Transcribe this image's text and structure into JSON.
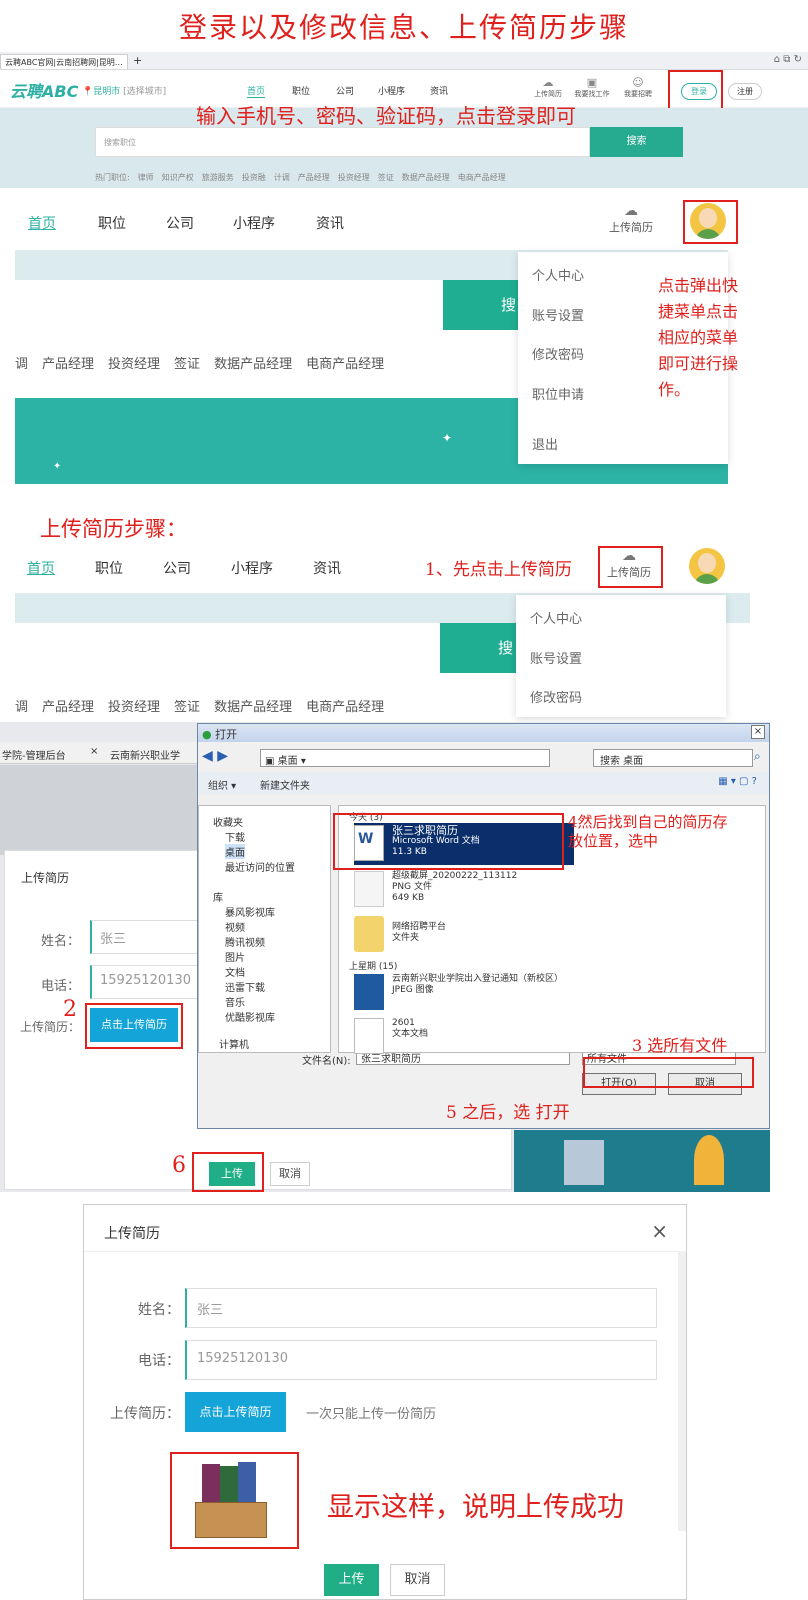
{
  "title": "登录以及修改信息、上传简历步骤",
  "browser": {
    "tab": "云聘ABC官网|云南招聘网|昆明…",
    "plus": "+"
  },
  "site": {
    "logo": "云聘ABC",
    "city": "昆明市",
    "city_select": "[选择城市]",
    "nav_small": [
      "首页",
      "职位",
      "公司",
      "小程序",
      "资讯"
    ],
    "icons_small": [
      "上传简历",
      "我要找工作",
      "我要招聘"
    ],
    "login": "登录",
    "register": "注册",
    "search_placeholder": "搜索职位",
    "search_btn": "搜索",
    "hot_label": "热门职位:",
    "hot": [
      "律师",
      "知识产权",
      "旅游服务",
      "投资融",
      "计调",
      "产品经理",
      "投资经理",
      "签证",
      "数据产品经理",
      "电商产品经理"
    ]
  },
  "step_login": "输入手机号、密码、验证码，点击登录即可",
  "nav": [
    "首页",
    "职位",
    "公司",
    "小程序",
    "资讯"
  ],
  "upload_resume": "上传简历",
  "search_partial": "搜",
  "tags": [
    "调",
    "产品经理",
    "投资经理",
    "签证",
    "数据产品经理",
    "电商产品经理"
  ],
  "dropdown": [
    "个人中心",
    "账号设置",
    "修改密码",
    "职位申请",
    "退出"
  ],
  "menu_note": [
    "点击弹出快",
    "捷菜单点击",
    "相应的菜单",
    "即可进行操",
    "作。"
  ],
  "upload_heading": "上传简历步骤：",
  "step1": "1、先点击上传简历",
  "step1_num": "1",
  "tabs2": [
    "学院-管理后台",
    "云南新兴职业学"
  ],
  "modal": {
    "title": "上传简历",
    "name_label": "姓名：",
    "name": "张三",
    "phone_label": "电话：",
    "phone": "15925120130",
    "resume_label": "上传简历：",
    "upload_btn": "点击上传简历",
    "note": "一次只能上传一份简历",
    "submit": "上传",
    "cancel": "取消"
  },
  "step2": "2",
  "step6": "6",
  "file_dialog": {
    "title": "打开",
    "path": "桌面",
    "search": "搜索 桌面",
    "organize": "组织",
    "new_folder": "新建文件夹",
    "tree": [
      "收藏夹",
      "下载",
      "桌面",
      "最近访问的位置",
      "库",
      "暴风影视库",
      "视频",
      "腾讯视频",
      "图片",
      "文档",
      "迅雷下载",
      "音乐",
      "优酷影视库",
      "计算机"
    ],
    "today": "今天 (3)",
    "lastweek": "上星期 (15)",
    "files": [
      {
        "name": "张三求职简历",
        "type": "Microsoft Word 文档",
        "size": "11.3 KB"
      },
      {
        "name": "超级截屏_20200222_113112",
        "type": "PNG 文件",
        "size": "649 KB"
      },
      {
        "name": "网络招聘平台",
        "type": "文件夹",
        "size": ""
      },
      {
        "name": "云南新兴职业学院出入登记通知（新校区）",
        "type": "JPEG 图像",
        "size": ""
      },
      {
        "name": "2601",
        "type": "文本文档",
        "size": ""
      }
    ],
    "filename_label": "文件名(N):",
    "filename": "张三求职简历",
    "filter": "所有文件",
    "open": "打开(O)",
    "cancel": "取消"
  },
  "step3": "3 选所有文件",
  "step4": "4然后找到自己的简历存放位置，选中",
  "step5": "5 之后，选 打开",
  "success": "显示这样，说明上传成功"
}
